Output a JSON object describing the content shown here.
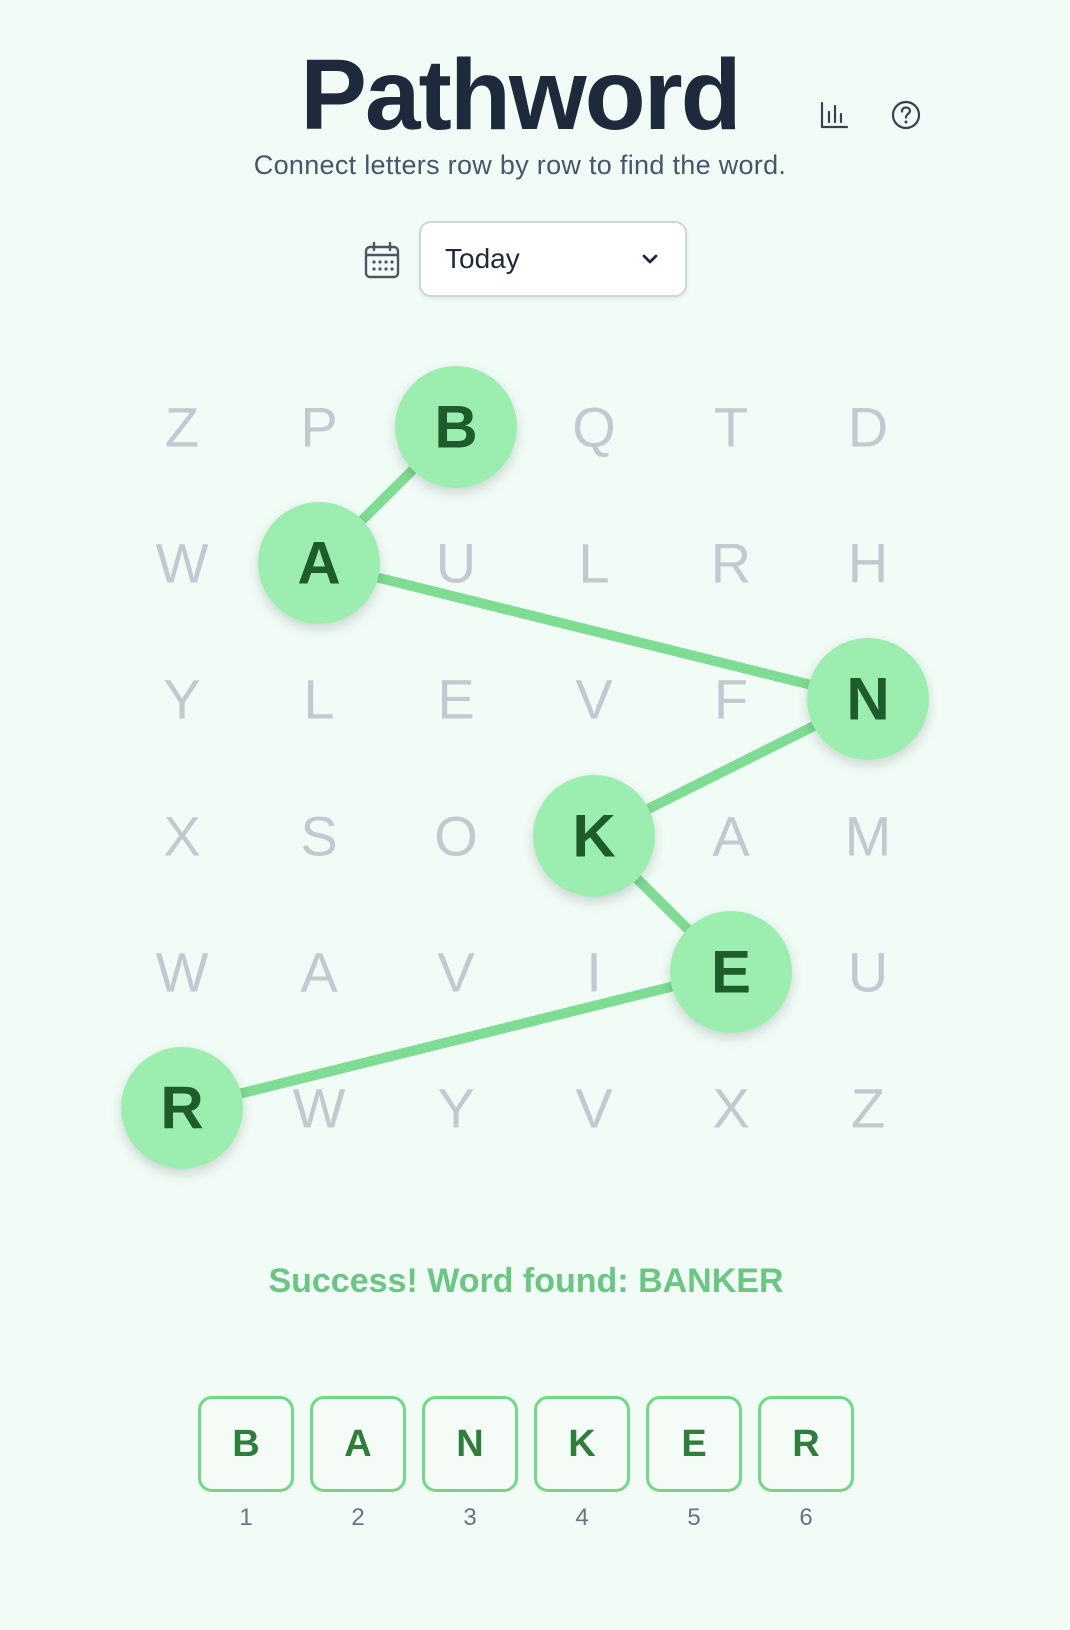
{
  "header": {
    "title": "Pathword",
    "subtitle": "Connect letters row by row to find the word.",
    "stats_icon": "bar-chart-icon",
    "help_icon": "help-circle-icon"
  },
  "date_picker": {
    "icon": "calendar-icon",
    "selected": "Today"
  },
  "grid": {
    "rows": [
      [
        "Z",
        "P",
        "B",
        "Q",
        "T",
        "D"
      ],
      [
        "W",
        "A",
        "U",
        "L",
        "R",
        "H"
      ],
      [
        "Y",
        "L",
        "E",
        "V",
        "F",
        "N"
      ],
      [
        "X",
        "S",
        "O",
        "K",
        "A",
        "M"
      ],
      [
        "W",
        "A",
        "V",
        "I",
        "E",
        "U"
      ],
      [
        "R",
        "W",
        "Y",
        "V",
        "X",
        "Z"
      ]
    ],
    "path_columns": [
      2,
      1,
      5,
      3,
      4,
      0
    ]
  },
  "status": {
    "message": "Success! Word found: BANKER"
  },
  "answer": {
    "letters": [
      "B",
      "A",
      "N",
      "K",
      "E",
      "R"
    ],
    "positions": [
      "1",
      "2",
      "3",
      "4",
      "5",
      "6"
    ]
  },
  "colors": {
    "selected_fill": "#9ceeb0",
    "path_line": "#7fdc93",
    "selected_text": "#1f5c2c",
    "unselected_text": "#c4c9d0",
    "success_text": "#6cc683",
    "tile_border": "#6fd989"
  }
}
